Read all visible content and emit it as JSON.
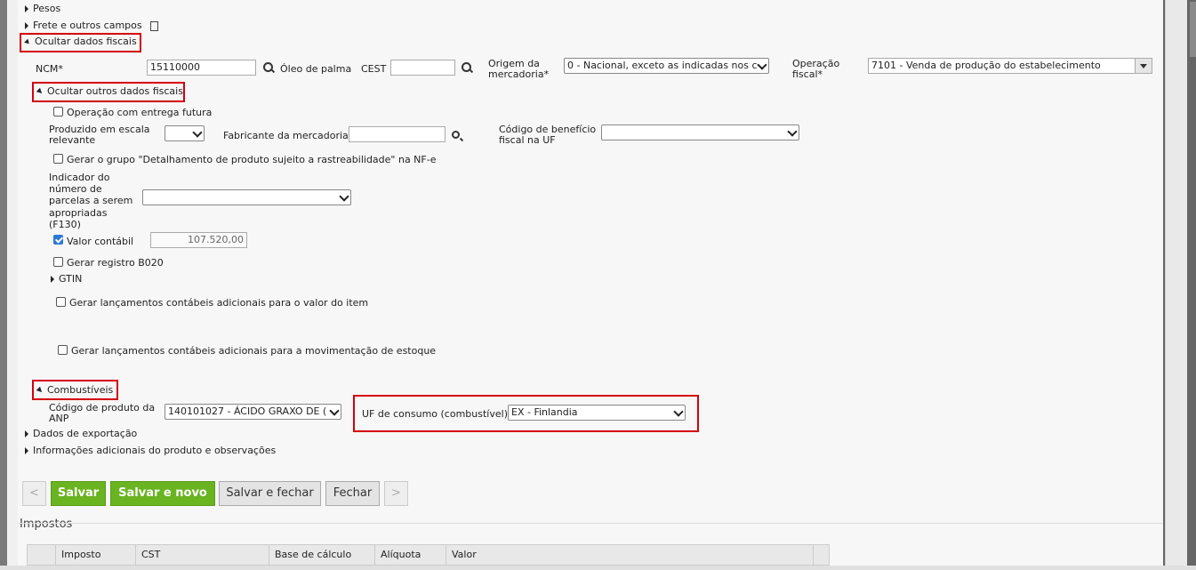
{
  "sections": {
    "pesos": "Pesos",
    "frete": "Frete e outros campos",
    "ocultar_fiscais": "Ocultar dados fiscais",
    "ocultar_outros": "Ocultar outros dados fiscais",
    "combustiveis": "Combustíveis",
    "exportacao": "Dados de exportação",
    "info_adicionais": "Informações adicionais do produto e observações",
    "gtin": "GTIN"
  },
  "fiscal": {
    "ncm_label": "NCM*",
    "ncm_value": "15110000",
    "ncm_desc": "Óleo de palma",
    "cest_label": "CEST",
    "cest_value": "",
    "origem_label_1": "Origem da",
    "origem_label_2": "mercadoria*",
    "origem_value": "0 - Nacional, exceto as indicadas nos c",
    "operacao_label_1": "Operação",
    "operacao_label_2": "fiscal*",
    "operacao_value": "7101 - Venda de produção do estabelecimento"
  },
  "outros": {
    "entrega_futura": "Operação com entrega futura",
    "escala_label_1": "Produzido em escala",
    "escala_label_2": "relevante",
    "escala_value": "",
    "fabricante_label": "Fabricante da mercadoria",
    "fabricante_value": "",
    "beneficio_label_1": "Código de benefício",
    "beneficio_label_2": "fiscal na UF",
    "beneficio_value": "",
    "rastreabilidade": "Gerar o grupo \"Detalhamento de produto sujeito a rastreabilidade\" na NF-e",
    "indicador_label": [
      "Indicador do",
      "número de",
      "parcelas a serem",
      "apropriadas",
      "(F130)"
    ],
    "indicador_value": "",
    "valor_contabil_label": "Valor contábil",
    "valor_contabil_value": "107.520,00",
    "b020": "Gerar registro B020",
    "lanc_valor": "Gerar lançamentos contábeis adicionais para o valor do item",
    "lanc_estoque": "Gerar lançamentos contábeis adicionais para a movimentação de estoque"
  },
  "combustivel": {
    "anp_label_1": "Código de produto da",
    "anp_label_2": "ANP",
    "anp_value": "140101027 - ÁCIDO GRAXO DE (",
    "uf_label": "UF de consumo (combustível)",
    "uf_value": "EX - Finlandia"
  },
  "buttons": {
    "prev": "<",
    "salvar": "Salvar",
    "salvar_novo": "Salvar e novo",
    "salvar_fechar": "Salvar e fechar",
    "fechar": "Fechar",
    "next": ">"
  },
  "impostos": {
    "title": "Impostos",
    "columns": [
      "Imposto",
      "CST",
      "Base de cálculo",
      "Alíquota",
      "Valor"
    ]
  },
  "colors": {
    "highlight": "#d4000a",
    "green": "#6ab321",
    "check": "#2b78d6"
  },
  "icons": [
    "caret-right-icon",
    "caret-down-icon",
    "document-icon",
    "search-icon",
    "chevron-down-icon",
    "checkbox-icon"
  ]
}
